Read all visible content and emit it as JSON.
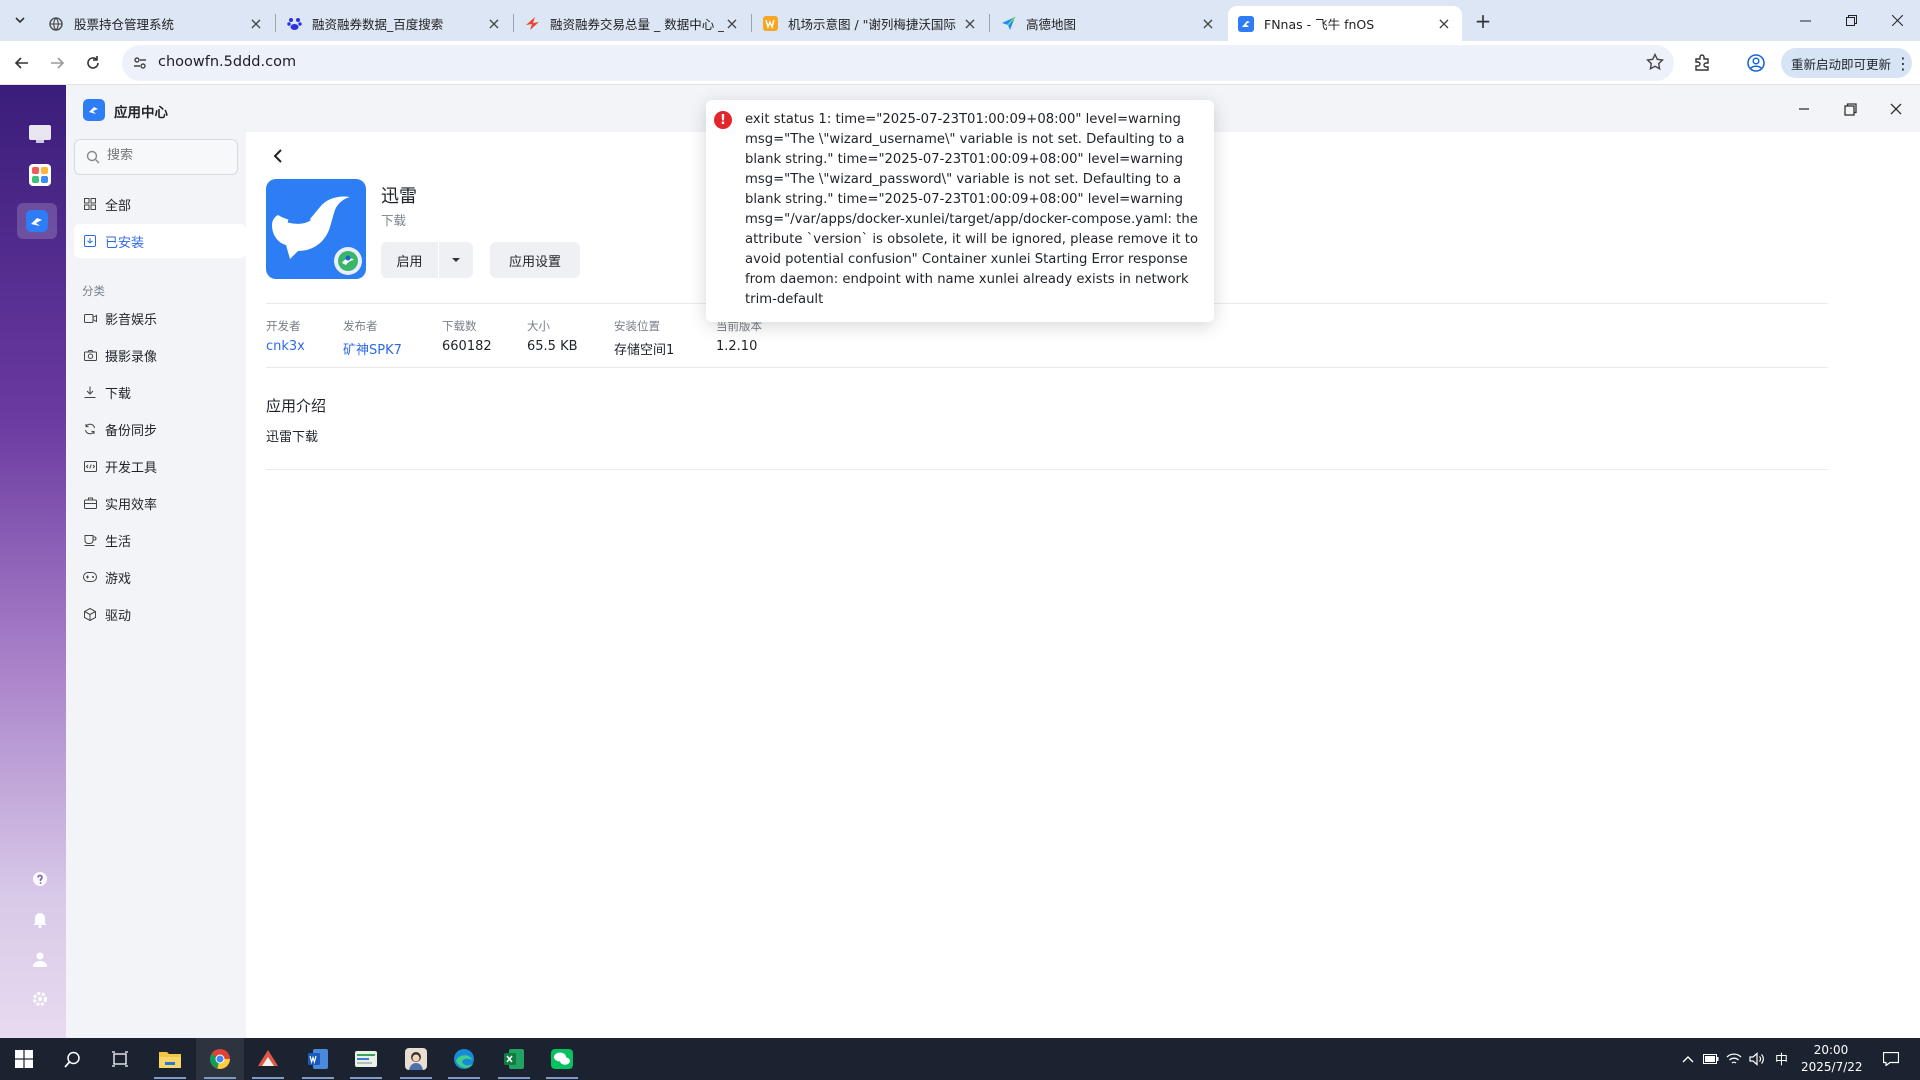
{
  "browser": {
    "tabs": [
      {
        "title": "股票持仓管理系统",
        "active": false
      },
      {
        "title": "融资融券数据_百度搜索",
        "active": false
      },
      {
        "title": "融资融券交易总量 _ 数据中心 _",
        "active": false
      },
      {
        "title": "机场示意图 / \"谢列梅捷沃国际",
        "active": false
      },
      {
        "title": "高德地图",
        "active": false
      },
      {
        "title": "FNnas - 飞牛 fnOS",
        "active": true
      }
    ],
    "url": "choowfn.5ddd.com",
    "update_button": "重新启动即可更新"
  },
  "app_center": {
    "title": "应用中心",
    "search_placeholder": "搜索",
    "nav": {
      "all": "全部",
      "installed": "已安装",
      "category_label": "分类",
      "categories": [
        "影音娱乐",
        "摄影录像",
        "下载",
        "备份同步",
        "开发工具",
        "实用效率",
        "生活",
        "游戏",
        "驱动"
      ]
    }
  },
  "app_detail": {
    "name": "迅雷",
    "category": "下载",
    "enable_button": "启用",
    "settings_button": "应用设置",
    "meta": [
      {
        "label": "开发者",
        "value": "cnk3x"
      },
      {
        "label": "发布者",
        "value": "矿神SPK7"
      },
      {
        "label": "下载数",
        "value": "660182"
      },
      {
        "label": "大小",
        "value": "65.5 KB"
      },
      {
        "label": "安装位置",
        "value": "存储空间1"
      },
      {
        "label": "当前版本",
        "value": "1.2.10"
      }
    ],
    "intro_title": "应用介绍",
    "intro_body": "迅雷下载"
  },
  "error_toast": {
    "message": "exit status 1: time=\"2025-07-23T01:00:09+08:00\" level=warning msg=\"The \\\"wizard_username\\\" variable is not set. Defaulting to a blank string.\" time=\"2025-07-23T01:00:09+08:00\" level=warning msg=\"The \\\"wizard_password\\\" variable is not set. Defaulting to a blank string.\" time=\"2025-07-23T01:00:09+08:00\" level=warning msg=\"/var/apps/docker-xunlei/target/app/docker-compose.yaml: the attribute `version` is obsolete, it will be ignored, please remove it to avoid potential confusion\" Container xunlei Starting Error response from daemon: endpoint with name xunlei already exists in network trim-default"
  },
  "taskbar": {
    "apps": [
      "file-explorer",
      "chrome",
      "foxmail",
      "word",
      "fnnas",
      "avatar-app",
      "edge",
      "excel",
      "wechat"
    ],
    "ime": "中",
    "time": "20:00",
    "date": "2025/7/22"
  },
  "colors": {
    "accent": "#2e6ae6",
    "error": "#e3262c",
    "tab_strip": "#dce6f5",
    "taskbar": "#1b2330"
  }
}
